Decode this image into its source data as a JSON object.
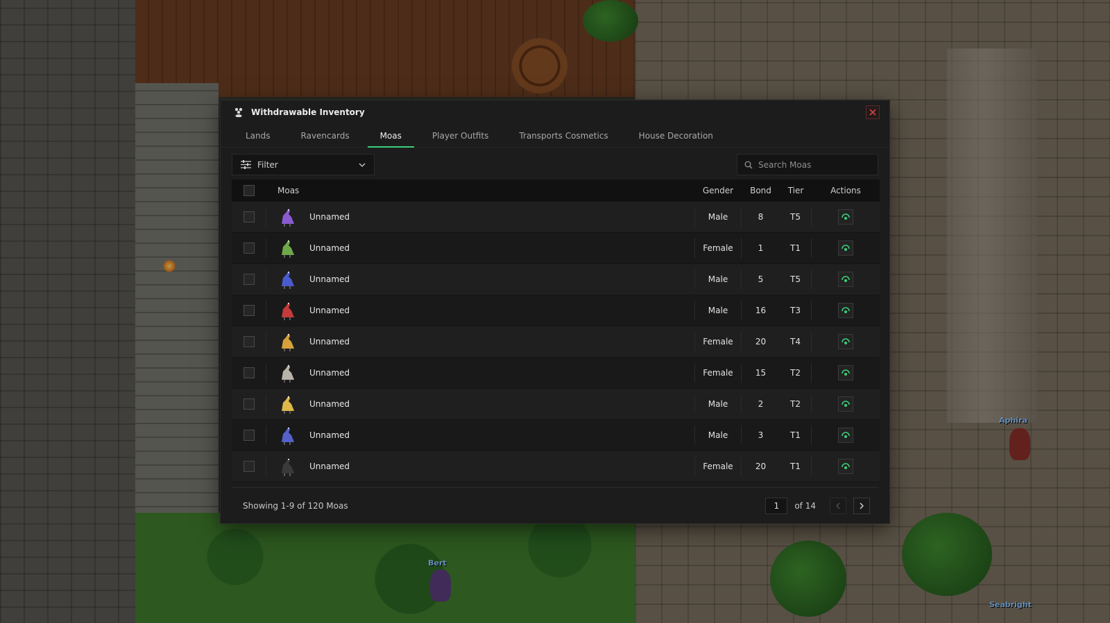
{
  "world": {
    "player_names": [
      "Aphira",
      "Bert",
      "Seabright"
    ]
  },
  "modal": {
    "title": "Withdrawable Inventory",
    "title_icon": "moa-footprint-icon",
    "close_icon": "close-icon"
  },
  "tabs": [
    {
      "label": "Lands",
      "active": false
    },
    {
      "label": "Ravencards",
      "active": false
    },
    {
      "label": "Moas",
      "active": true
    },
    {
      "label": "Player Outfits",
      "active": false
    },
    {
      "label": "Transports Cosmetics",
      "active": false
    },
    {
      "label": "House Decoration",
      "active": false
    }
  ],
  "toolbar": {
    "filter_label": "Filter",
    "filter_icon": "sliders-icon",
    "search_placeholder": "Search Moas",
    "search_value": ""
  },
  "table": {
    "headers": {
      "name": "Moas",
      "gender": "Gender",
      "bond": "Bond",
      "tier": "Tier",
      "actions": "Actions"
    },
    "rows": [
      {
        "name": "Unnamed",
        "gender": "Male",
        "bond": "8",
        "tier": "T5",
        "color": "#8a5bd0"
      },
      {
        "name": "Unnamed",
        "gender": "Female",
        "bond": "1",
        "tier": "T1",
        "color": "#6fa84a"
      },
      {
        "name": "Unnamed",
        "gender": "Male",
        "bond": "5",
        "tier": "T5",
        "color": "#4a5bd0"
      },
      {
        "name": "Unnamed",
        "gender": "Male",
        "bond": "16",
        "tier": "T3",
        "color": "#c53a3a"
      },
      {
        "name": "Unnamed",
        "gender": "Female",
        "bond": "20",
        "tier": "T4",
        "color": "#d6a13a"
      },
      {
        "name": "Unnamed",
        "gender": "Female",
        "bond": "15",
        "tier": "T2",
        "color": "#b8b3a8"
      },
      {
        "name": "Unnamed",
        "gender": "Male",
        "bond": "2",
        "tier": "T2",
        "color": "#e0b84a"
      },
      {
        "name": "Unnamed",
        "gender": "Male",
        "bond": "3",
        "tier": "T1",
        "color": "#5560c8"
      },
      {
        "name": "Unnamed",
        "gender": "Female",
        "bond": "20",
        "tier": "T1",
        "color": "#3a3a3a"
      }
    ],
    "action_icon": "withdraw-icon"
  },
  "footer": {
    "showing": "Showing 1-9 of 120 Moas",
    "page": "1",
    "of_label": "of 14"
  },
  "colors": {
    "accent": "#3bd07a",
    "close": "#d0443c",
    "panel": "#1c1c1c"
  }
}
